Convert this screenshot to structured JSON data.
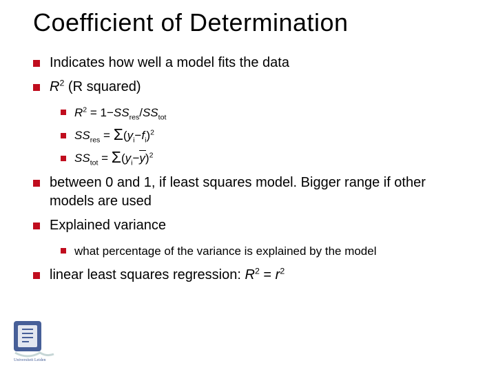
{
  "title": "Coefficient of Determination",
  "bullets": {
    "b1": "Indicates how well a model fits the data",
    "b2": {
      "prefix_it": "R",
      "sup": "2",
      "rest": " (R squared)",
      "sub": {
        "eq1": {
          "r": "R",
          "sup": "2",
          "eq": " = 1−",
          "ss": "SS",
          "sub1": "res",
          "slash": "/",
          "ss2": "SS",
          "sub2": "tot"
        },
        "eq2": {
          "ss": "SS",
          "sub1": "res",
          "eq": " = ",
          "sigma": "Σ",
          "open": "(",
          "y": "y",
          "ysub": "i",
          "minus": "−",
          "f": "f",
          "fsub": "i",
          "close": ")",
          "pow": "2"
        },
        "eq3": {
          "ss": "SS",
          "sub1": "tot",
          "eq": " = ",
          "sigma": "Σ",
          "open": "(",
          "y": "y",
          "ysub": "i",
          "minus": "−",
          "ybar": "y",
          "close": ")",
          "pow": "2"
        }
      }
    },
    "b3": "between 0 and 1, if least squares model. Bigger range if other models are used",
    "b4": {
      "label": "Explained variance",
      "sub": "what percentage of the variance is explained by the model"
    },
    "b5": {
      "prefix": "linear least squares regression: ",
      "R": "R",
      "sup1": "2",
      "eq": " = ",
      "r": "r",
      "sup2": "2"
    }
  },
  "logo": {
    "name": "leiden-university-logo",
    "caption": "Universiteit Leiden"
  }
}
